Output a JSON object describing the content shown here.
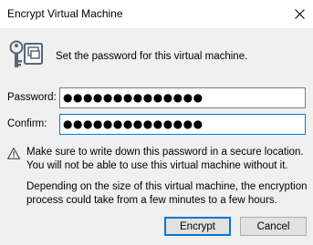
{
  "window": {
    "title": "Encrypt Virtual Machine",
    "icons": {
      "close": "close-icon",
      "app": "vm-lock-icon"
    }
  },
  "intro_text": "Set the password for this virtual machine.",
  "password": {
    "label": "Password:",
    "value": "●●●●●●●●●●●●●●"
  },
  "confirm": {
    "label": "Confirm:",
    "value": "●●●●●●●●●●●●●●"
  },
  "warning": {
    "icon": "warning-icon",
    "text": "Make sure to write down this password in a secure location. You will not be able to use this virtual machine without it."
  },
  "info_text": "Depending on the size of this virtual machine, the encryption process could take from a few minutes to a few hours.",
  "buttons": {
    "encrypt": "Encrypt",
    "cancel": "Cancel"
  },
  "colors": {
    "accent": "#0078d7",
    "dialog_bg": "#f0f0f0",
    "button_bg": "#e1e1e1"
  }
}
